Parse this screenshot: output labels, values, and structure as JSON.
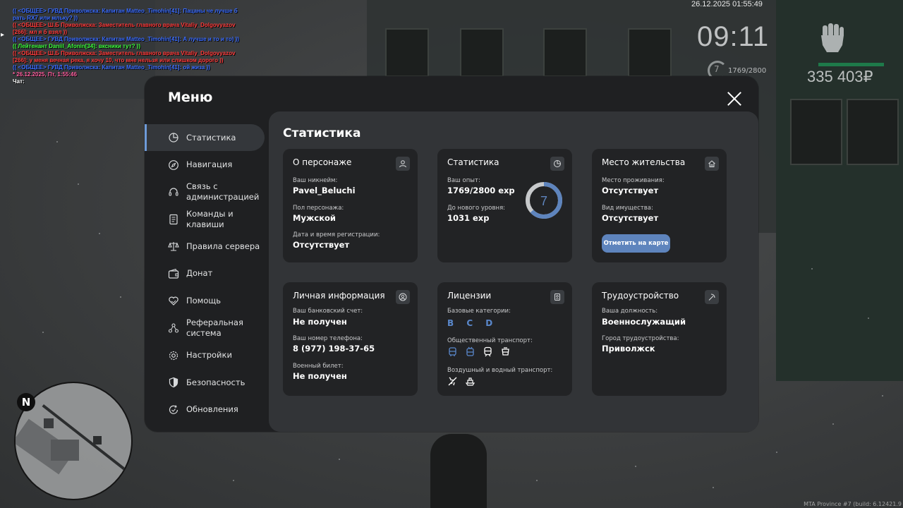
{
  "chat": {
    "lines": [
      {
        "text": "(( <ОБЩЕЕ> ГУВД Приволжска: Капитан Matteo_Timohin[41]: Пацаны че лучше б",
        "color": "blue"
      },
      {
        "text": "рать RX7 или мльку? ))",
        "color": "blue"
      },
      {
        "text": "(( <ОБЩЕЕ> Ш.Б Приволжска: Заместитель главного врача Vitaliy_Dolgovyazov",
        "color": "red"
      },
      {
        "text": "[266]: мл я б взял ))",
        "color": "red"
      },
      {
        "text": "(( <ОБЩЕЕ> ГУВД Приволжска: Капитан Matteo_Timohin[41]: А лучше и то и то) ))",
        "color": "blue"
      },
      {
        "text": "(( Лейтенант Daniil_Afonin[34]: вксники тут? ))",
        "color": "green"
      },
      {
        "text": "(( <ОБЩЕЕ> Ш.Б Приволжска: Заместитель главного врача Vitaliy_Dolgovyazov",
        "color": "red"
      },
      {
        "text": "[266]: у меня вечная река, я хочу 10, что мне нельзя или слишком дорого ))",
        "color": "red"
      },
      {
        "text": "(( <ОБЩЕЕ> ГУВД Приволжска: Капитан Matteo_Timohin[41]: ой жиза ))",
        "color": "blue"
      },
      {
        "text": "* 26.12.2025, Пт, 1:55:46",
        "color": "pink"
      },
      {
        "text": "Чат:",
        "color": "white"
      }
    ]
  },
  "hud": {
    "datetime": "26.12.2025 01:55:49",
    "time": "09:11",
    "level": "7",
    "exp": "1769/2800",
    "money": "335 403₽"
  },
  "build": "MTA Province #7 (build: 6.12421.9",
  "minimap": {
    "north": "N"
  },
  "menu": {
    "title": "Меню",
    "sidebar": [
      {
        "label": "Статистика",
        "icon": "pie-chart-icon",
        "active": true
      },
      {
        "label": "Навигация",
        "icon": "compass-icon",
        "active": false
      },
      {
        "label": "Связь с администрацией",
        "icon": "headset-icon",
        "active": false
      },
      {
        "label": "Команды и клавиши",
        "icon": "document-icon",
        "active": false
      },
      {
        "label": "Правила сервера",
        "icon": "scales-icon",
        "active": false
      },
      {
        "label": "Донат",
        "icon": "wallet-icon",
        "active": false
      },
      {
        "label": "Помощь",
        "icon": "heart-hand-icon",
        "active": false
      },
      {
        "label": "Реферальная система",
        "icon": "network-icon",
        "active": false
      },
      {
        "label": "Настройки",
        "icon": "gear-icon",
        "active": false
      },
      {
        "label": "Безопасность",
        "icon": "shield-icon",
        "active": false
      },
      {
        "label": "Обновления",
        "icon": "refresh-check-icon",
        "active": false
      }
    ],
    "panel_title": "Статистика",
    "cards": {
      "character": {
        "title": "О персонаже",
        "nickname_label": "Ваш никнейм:",
        "nickname": "Pavel_Beluchi",
        "gender_label": "Пол персонажа:",
        "gender": "Мужской",
        "reg_label": "Дата и время регистрации:",
        "reg": "Отсутствует"
      },
      "stats": {
        "title": "Статистика",
        "exp_label": "Ваш опыт:",
        "exp": "1769/2800 exp",
        "next_label": "До нового уровня:",
        "next": "1031 exp",
        "level": "7",
        "progress": 0.632
      },
      "residence": {
        "title": "Место жительства",
        "place_label": "Место проживания:",
        "place": "Отсутствует",
        "property_label": "Вид имущества:",
        "property": "Отсутствует",
        "button": "Отметить на карте"
      },
      "personal": {
        "title": "Личная информация",
        "bank_label": "Ваш банковский счет:",
        "bank": "Не получен",
        "phone_label": "Ваш номер телефона:",
        "phone": "8 (977) 198-37-65",
        "military_label": "Военный билет:",
        "military": "Не получен"
      },
      "licenses": {
        "title": "Лицензии",
        "basic_label": "Базовые категории:",
        "basic": "B C D",
        "public_label": "Общественный транспорт:",
        "air_label": "Воздушный и водный транспорт:"
      },
      "job": {
        "title": "Трудоустройство",
        "position_label": "Ваша должность:",
        "position": "Военнослужащий",
        "city_label": "Город трудоустройства:",
        "city": "Приволжск"
      }
    }
  },
  "colors": {
    "accent": "#5e84bd",
    "active_bar": "#6e9bd8",
    "card": "#222325",
    "panel": "#323437",
    "menu": "#1f2022"
  }
}
